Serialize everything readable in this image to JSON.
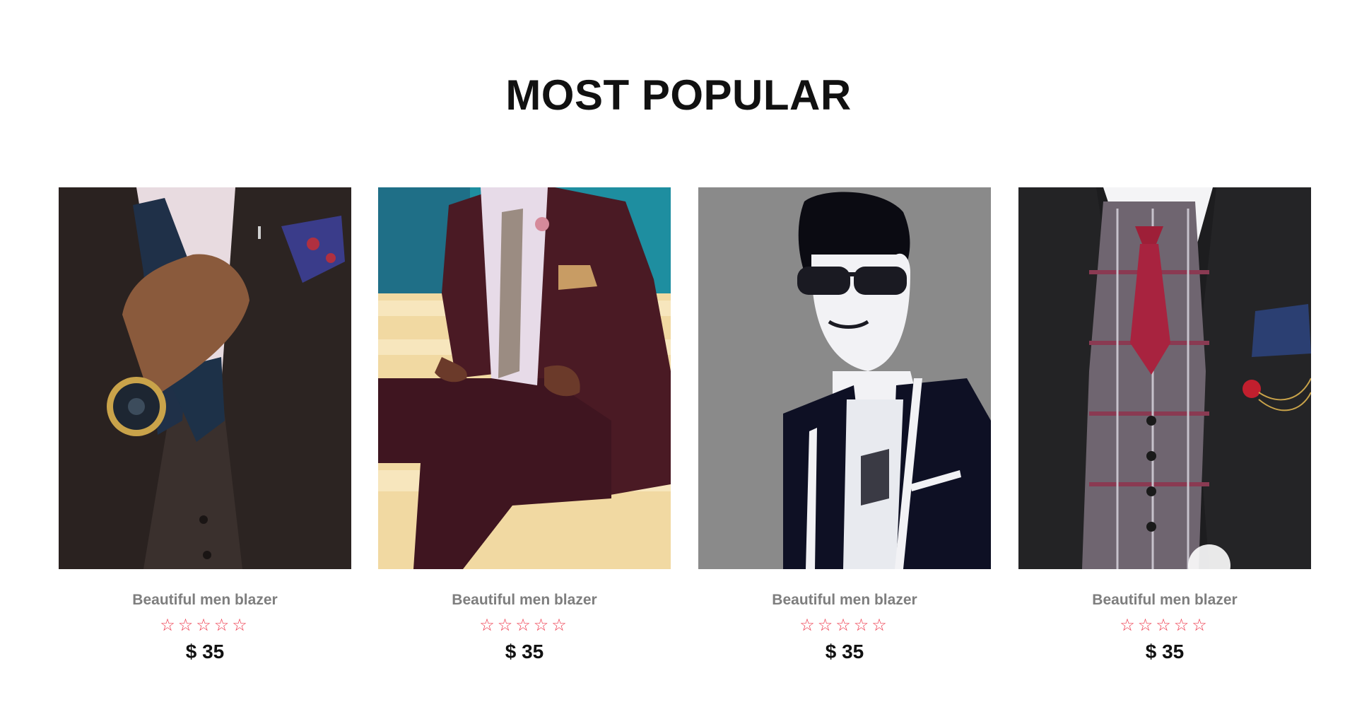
{
  "section": {
    "title": "MOST POPULAR"
  },
  "products": [
    {
      "name": "Beautiful men blazer",
      "rating_stars": "☆☆☆☆☆",
      "price": "$ 35",
      "image": "man-in-dark-suit-with-watch-photo"
    },
    {
      "name": "Beautiful men blazer",
      "rating_stars": "☆☆☆☆☆",
      "price": "$ 35",
      "image": "man-in-maroon-suit-sitting-on-steps-photo"
    },
    {
      "name": "Beautiful men blazer",
      "rating_stars": "☆☆☆☆☆",
      "price": "$ 35",
      "image": "man-in-sunglasses-and-blazer-photo"
    },
    {
      "name": "Beautiful men blazer",
      "rating_stars": "☆☆☆☆☆",
      "price": "$ 35",
      "image": "man-in-plaid-vest-and-red-tie-photo"
    }
  ],
  "colors": {
    "star": "#ee3b4e",
    "name_text": "#7e7e7e",
    "price_text": "#111111"
  }
}
